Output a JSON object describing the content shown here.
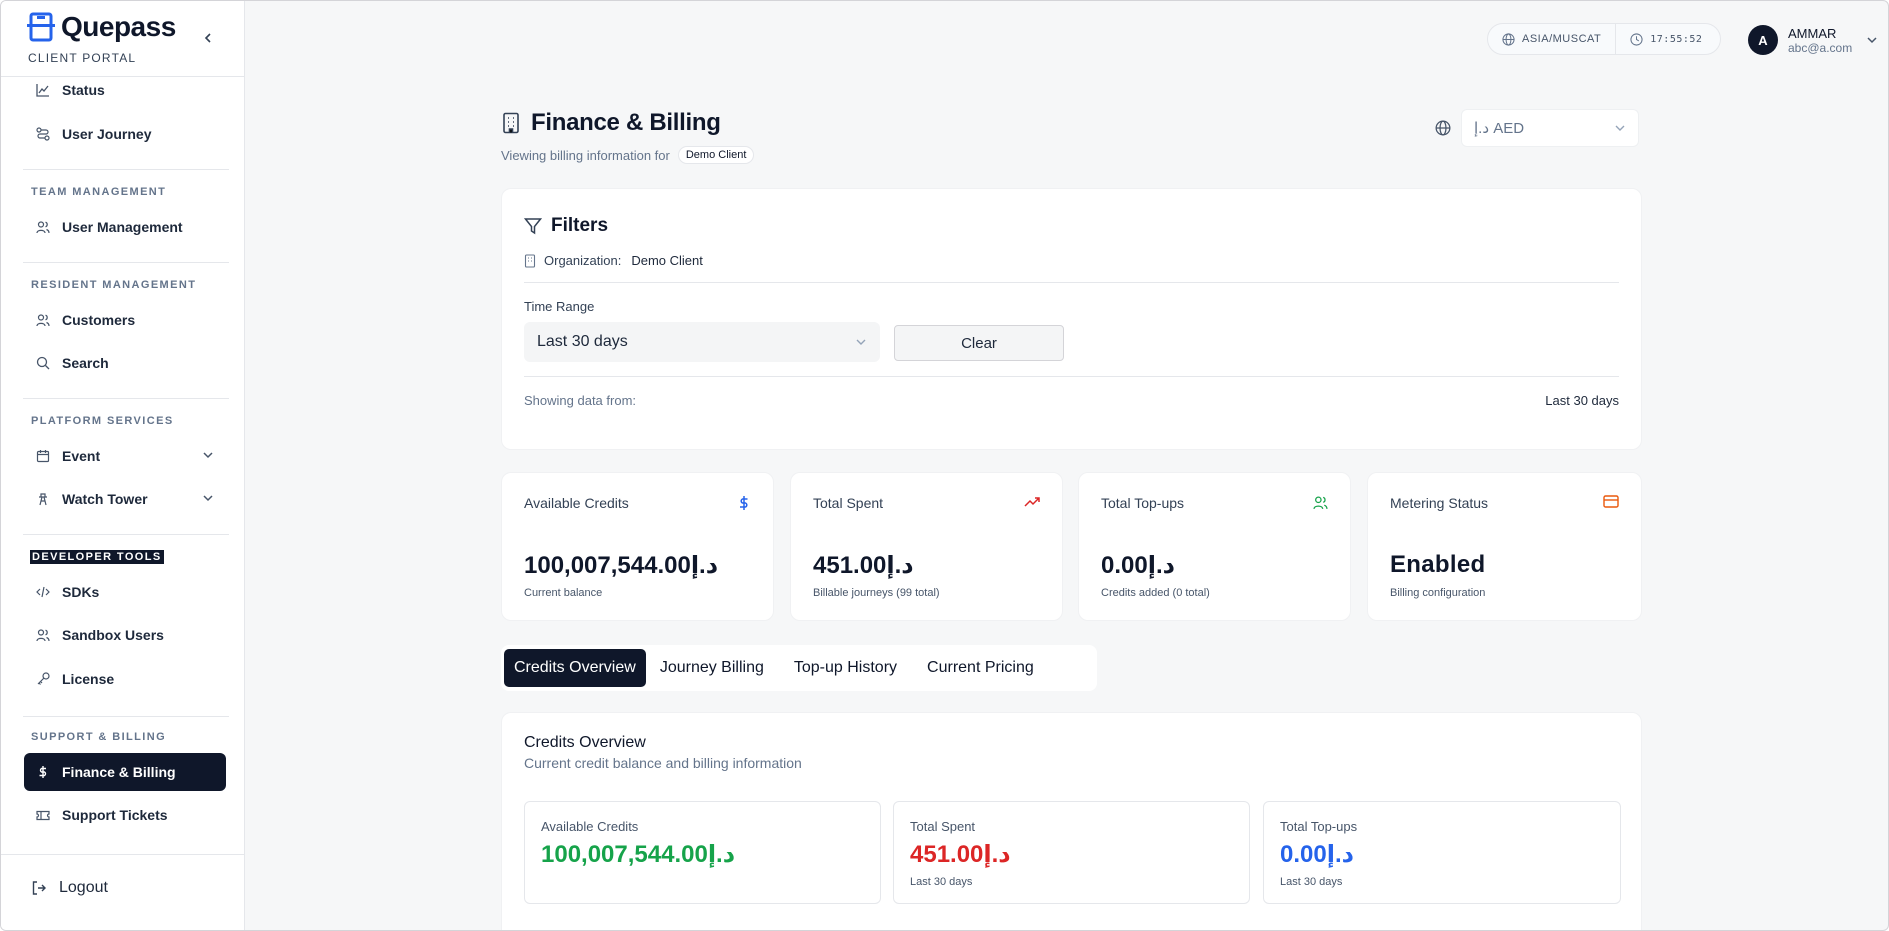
{
  "brand": {
    "name": "Quepass",
    "subtitle": "CLIENT PORTAL"
  },
  "sidebar": {
    "items_top": [
      {
        "label": "Status",
        "icon": "chart-line-icon"
      },
      {
        "label": "User Journey",
        "icon": "route-icon"
      }
    ],
    "sections": [
      {
        "title": "TEAM MANAGEMENT",
        "items": [
          {
            "label": "User Management",
            "icon": "users-icon"
          }
        ]
      },
      {
        "title": "RESIDENT MANAGEMENT",
        "items": [
          {
            "label": "Customers",
            "icon": "users-icon"
          },
          {
            "label": "Search",
            "icon": "search-icon"
          }
        ]
      },
      {
        "title": "PLATFORM SERVICES",
        "items": [
          {
            "label": "Event",
            "icon": "calendar-icon"
          },
          {
            "label": "Watch Tower",
            "icon": "tower-icon"
          }
        ]
      },
      {
        "title": "DEVELOPER TOOLS",
        "items": [
          {
            "label": "SDKs",
            "icon": "code-icon"
          },
          {
            "label": "Sandbox Users",
            "icon": "users-icon"
          },
          {
            "label": "License",
            "icon": "key-icon"
          }
        ]
      },
      {
        "title": "SUPPORT & BILLING",
        "items": [
          {
            "label": "Finance & Billing",
            "icon": "dollar-icon",
            "active": true
          },
          {
            "label": "Support Tickets",
            "icon": "ticket-icon"
          }
        ]
      }
    ],
    "logout": "Logout"
  },
  "topbar": {
    "timezone": "ASIA/MUSCAT",
    "time": "17:55:52",
    "user": {
      "initial": "A",
      "name": "AMMAR",
      "email": "abc@a.com"
    }
  },
  "page": {
    "title": "Finance & Billing",
    "subtitle": "Viewing billing information for",
    "client_badge": "Demo Client",
    "currency": {
      "symbol": "د.إ",
      "code": "AED"
    }
  },
  "filters": {
    "title": "Filters",
    "org_label": "Organization:",
    "org_value": "Demo Client",
    "time_range_label": "Time Range",
    "time_range_value": "Last 30 days",
    "clear": "Clear",
    "showing_label": "Showing data from:",
    "showing_value": "Last 30 days"
  },
  "stats": [
    {
      "title": "Available Credits",
      "value": "100,007,544.00د.إ",
      "sub": "Current balance",
      "icon": "dollar-icon",
      "icon_color": "#2563eb"
    },
    {
      "title": "Total Spent",
      "value": "451.00د.إ",
      "sub": "Billable journeys (99 total)",
      "icon": "trending-up-icon",
      "icon_color": "#dc2626"
    },
    {
      "title": "Total Top-ups",
      "value": "0.00د.إ",
      "sub": "Credits added (0 total)",
      "icon": "users-icon",
      "icon_color": "#16a34a"
    },
    {
      "title": "Metering Status",
      "value": "Enabled",
      "sub": "Billing configuration",
      "icon": "credit-card-icon",
      "icon_color": "#ea580c"
    }
  ],
  "tabs": [
    "Credits Overview",
    "Journey Billing",
    "Top-up History",
    "Current Pricing"
  ],
  "credits_overview": {
    "title": "Credits Overview",
    "subtitle": "Current credit balance and billing information",
    "cards": [
      {
        "label": "Available Credits",
        "value": "100,007,544.00د.إ",
        "sub": "",
        "color": "#16a34a"
      },
      {
        "label": "Total Spent",
        "value": "451.00د.إ",
        "sub": "Last 30 days",
        "color": "#dc2626"
      },
      {
        "label": "Total Top-ups",
        "value": "0.00د.إ",
        "sub": "Last 30 days",
        "color": "#2563eb"
      }
    ]
  }
}
